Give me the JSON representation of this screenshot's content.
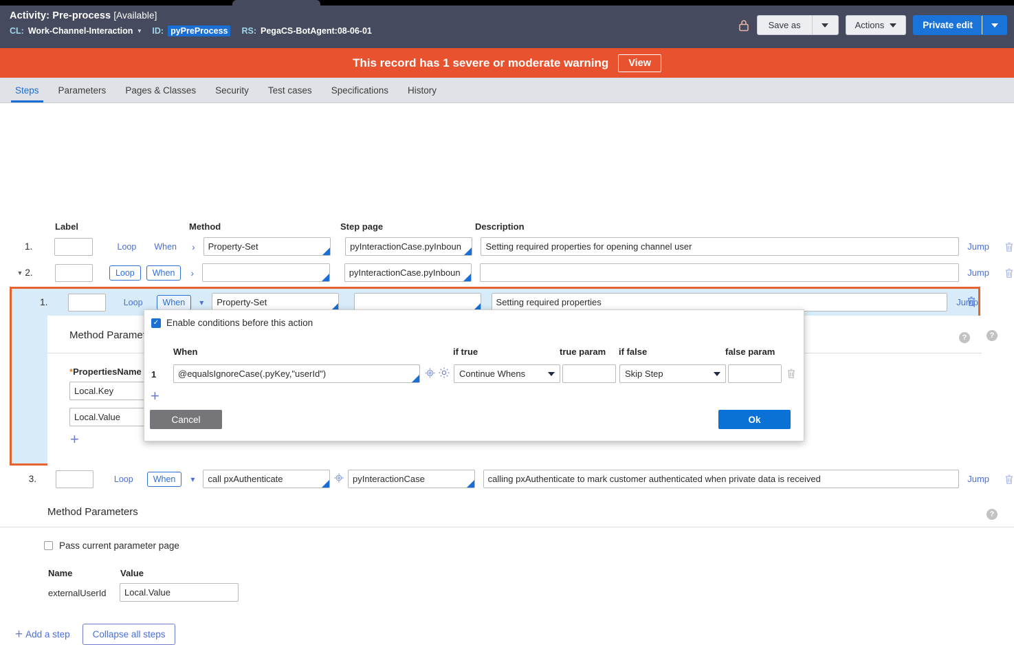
{
  "header": {
    "title_prefix": "Activity:",
    "title_name": "Pre-process",
    "availability": "[Available]",
    "cl_key": "CL:",
    "cl_value": "Work-Channel-Interaction",
    "id_key": "ID:",
    "id_value": "pyPreProcess",
    "rs_key": "RS:",
    "rs_value": "PegaCS-BotAgent:08-06-01",
    "lock_icon": "lock-icon",
    "save_as_label": "Save as",
    "actions_label": "Actions",
    "private_edit_label": "Private edit"
  },
  "warning": {
    "message": "This record has 1 severe or moderate warning",
    "view_label": "View",
    "color": "#e8522f"
  },
  "tabs": [
    {
      "label": "Steps",
      "active": true
    },
    {
      "label": "Parameters",
      "active": false
    },
    {
      "label": "Pages & Classes",
      "active": false
    },
    {
      "label": "Security",
      "active": false
    },
    {
      "label": "Test cases",
      "active": false
    },
    {
      "label": "Specifications",
      "active": false
    },
    {
      "label": "History",
      "active": false
    }
  ],
  "columns": {
    "label": "Label",
    "method": "Method",
    "step_page": "Step page",
    "description": "Description"
  },
  "steps": [
    {
      "number": "1.",
      "label_value": "",
      "loop_label": "Loop",
      "when_label": "When",
      "method": "Property-Set",
      "step_page": "pyInteractionCase.pyInboun",
      "description": "Setting required properties for opening channel user",
      "jump_label": "Jump",
      "delete_icon": "trash-icon"
    },
    {
      "number": "2.",
      "label_value": "",
      "loop_label": "Loop",
      "when_label": "When",
      "method": "",
      "step_page": "pyInteractionCase.pyInboun",
      "description": "",
      "jump_label": "Jump",
      "delete_icon": "trash-icon"
    }
  ],
  "nested_step": {
    "number": "1.",
    "label_value": "",
    "loop_label": "Loop",
    "when_label": "When",
    "method": "Property-Set",
    "step_page": "",
    "description": "Setting required properties",
    "jump_label": "Jump",
    "delete_icon": "trash-icon",
    "method_parameters": {
      "title": "Method Parameters",
      "help_icon": "help-icon",
      "required_marker": "*",
      "column_header": "PropertiesName",
      "rows": [
        {
          "value": "Local.Key"
        },
        {
          "value": "Local.Value"
        }
      ],
      "add_icon": "plus-icon"
    }
  },
  "popup": {
    "enable_conditions_label": "Enable conditions before this action",
    "enable_conditions_checked": true,
    "columns": {
      "when": "When",
      "if_true": "if true",
      "true_param": "true param",
      "if_false": "if false",
      "false_param": "false param"
    },
    "conditions": [
      {
        "index": "1",
        "when_expression": "@equalsIgnoreCase(.pyKey,\"userId\")",
        "crosshair_icon": "target-icon",
        "gear_icon": "gear-icon",
        "if_true": "Continue Whens",
        "true_param": "",
        "if_false": "Skip Step",
        "false_param": "",
        "delete_icon": "trash-icon"
      }
    ],
    "add_row_icon": "plus-icon",
    "cancel_label": "Cancel",
    "ok_label": "Ok"
  },
  "step3": {
    "number": "3.",
    "label_value": "",
    "loop_label": "Loop",
    "when_label": "When",
    "method": "call pxAuthenticate",
    "target_icon": "target-icon",
    "step_page": "pyInteractionCase",
    "description": "calling pxAuthenticate to mark customer authenticated when private data is received",
    "jump_label": "Jump",
    "delete_icon": "trash-icon",
    "method_parameters": {
      "title": "Method Parameters",
      "help_icon": "help-icon",
      "pass_param_label": "Pass current parameter page",
      "pass_param_checked": false,
      "col_name": "Name",
      "col_value": "Value",
      "rows": [
        {
          "name": "externalUserId",
          "value": "Local.Value"
        }
      ]
    }
  },
  "footer": {
    "add_step_label": "Add a step",
    "add_step_icon": "plus-icon",
    "collapse_all_label": "Collapse all steps"
  },
  "colors": {
    "header_bg": "#454a5e",
    "accent_blue": "#1a6fd4",
    "warning_red": "#e8522f",
    "highlight_bg": "#d7ecf8"
  }
}
